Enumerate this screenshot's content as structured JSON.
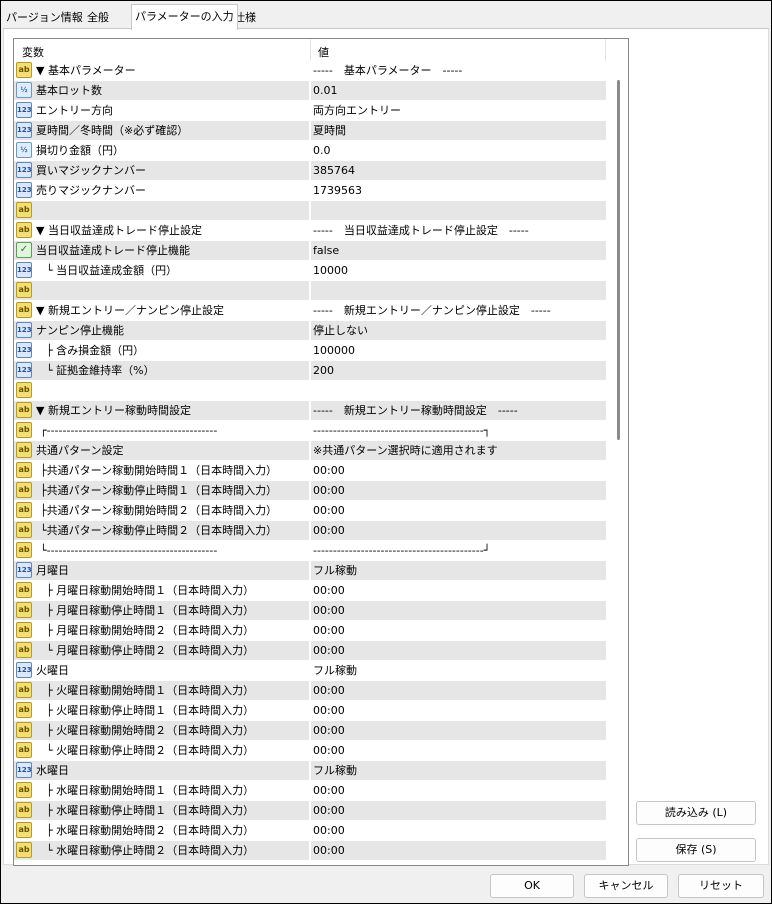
{
  "tabs": [
    "パージョン情報",
    "全般",
    "パラメーターの入力",
    "仕様"
  ],
  "grid": {
    "header_name": "変数",
    "header_value": "値",
    "rows": [
      {
        "icon": "ab",
        "name": "▼ 基本パラメーター",
        "value": "-----　基本パラメーター　-----"
      },
      {
        "icon": "frac",
        "name": "基本ロット数",
        "value": "0.01"
      },
      {
        "icon": "num",
        "name": "エントリー方向",
        "value": "両方向エントリー"
      },
      {
        "icon": "num",
        "name": "夏時間／冬時間（※必ず確認）",
        "value": "夏時間"
      },
      {
        "icon": "frac",
        "name": "損切り金額（円）",
        "value": "0.0"
      },
      {
        "icon": "num",
        "name": "買いマジックナンバー",
        "value": "385764"
      },
      {
        "icon": "num",
        "name": "売りマジックナンバー",
        "value": "1739563"
      },
      {
        "icon": "ab",
        "name": "",
        "value": ""
      },
      {
        "icon": "ab",
        "name": "▼ 当日収益達成トレード停止設定",
        "value": "-----　当日収益達成トレード停止設定　-----"
      },
      {
        "icon": "bool",
        "name": "当日収益達成トレード停止機能",
        "value": "false"
      },
      {
        "icon": "num",
        "indent": 2,
        "name": "└ 当日収益達成金額（円）",
        "value": "10000"
      },
      {
        "icon": "ab",
        "name": "",
        "value": ""
      },
      {
        "icon": "ab",
        "name": "▼ 新規エントリー／ナンピン停止設定",
        "value": "-----　新規エントリー／ナンピン停止設定　-----"
      },
      {
        "icon": "num",
        "name": "ナンピン停止機能",
        "value": "停止しない"
      },
      {
        "icon": "num",
        "indent": 2,
        "name": "├ 含み損金額（円）",
        "value": "100000"
      },
      {
        "icon": "num",
        "indent": 2,
        "name": "└ 証拠金維持率（%）",
        "value": "200"
      },
      {
        "icon": "ab",
        "name": "",
        "value": ""
      },
      {
        "icon": "ab",
        "name": "▼ 新規エントリー稼動時間設定",
        "value": "-----　新規エントリー稼動時間設定　-----"
      },
      {
        "icon": "ab",
        "indent": 1,
        "name": "┌-------------------------------------------",
        "value": "-------------------------------------------┐"
      },
      {
        "icon": "ab",
        "name": "共通パターン設定",
        "value": "※共通パターン選択時に適用されます"
      },
      {
        "icon": "ab",
        "indent": 1,
        "name": "├共通パターン稼動開始時間１（日本時間入力）",
        "value": "00:00"
      },
      {
        "icon": "ab",
        "indent": 1,
        "name": "├共通パターン稼動停止時間１（日本時間入力）",
        "value": "00:00"
      },
      {
        "icon": "ab",
        "indent": 1,
        "name": "├共通パターン稼動開始時間２（日本時間入力）",
        "value": "00:00"
      },
      {
        "icon": "ab",
        "indent": 1,
        "name": "└共通パターン稼動停止時間２（日本時間入力）",
        "value": "00:00"
      },
      {
        "icon": "ab",
        "indent": 1,
        "name": "└-------------------------------------------",
        "value": "-------------------------------------------┘"
      },
      {
        "icon": "num",
        "name": "月曜日",
        "value": "フル稼動"
      },
      {
        "icon": "ab",
        "indent": 2,
        "name": "├ 月曜日稼動開始時間１（日本時間入力）",
        "value": "00:00"
      },
      {
        "icon": "ab",
        "indent": 2,
        "name": "├ 月曜日稼動停止時間１（日本時間入力）",
        "value": "00:00"
      },
      {
        "icon": "ab",
        "indent": 2,
        "name": "├ 月曜日稼動開始時間２（日本時間入力）",
        "value": "00:00"
      },
      {
        "icon": "ab",
        "indent": 2,
        "name": "└ 月曜日稼動停止時間２（日本時間入力）",
        "value": "00:00"
      },
      {
        "icon": "num",
        "name": "火曜日",
        "value": "フル稼動"
      },
      {
        "icon": "ab",
        "indent": 2,
        "name": "├ 火曜日稼動開始時間１（日本時間入力）",
        "value": "00:00"
      },
      {
        "icon": "ab",
        "indent": 2,
        "name": "├ 火曜日稼動停止時間１（日本時間入力）",
        "value": "00:00"
      },
      {
        "icon": "ab",
        "indent": 2,
        "name": "├ 火曜日稼動開始時間２（日本時間入力）",
        "value": "00:00"
      },
      {
        "icon": "ab",
        "indent": 2,
        "name": "└ 火曜日稼動停止時間２（日本時間入力）",
        "value": "00:00"
      },
      {
        "icon": "num",
        "name": "水曜日",
        "value": "フル稼動"
      },
      {
        "icon": "ab",
        "indent": 2,
        "name": "├ 水曜日稼動開始時間１（日本時間入力）",
        "value": "00:00"
      },
      {
        "icon": "ab",
        "indent": 2,
        "name": "├ 水曜日稼動停止時間１（日本時間入力）",
        "value": "00:00"
      },
      {
        "icon": "ab",
        "indent": 2,
        "name": "├ 水曜日稼動開始時間２（日本時間入力）",
        "value": "00:00"
      },
      {
        "icon": "ab",
        "indent": 2,
        "name": "└ 水曜日稼動停止時間２（日本時間入力）",
        "value": "00:00"
      }
    ]
  },
  "buttons": {
    "load": "読み込み (L)",
    "save": "保存 (S)",
    "ok": "OK",
    "cancel": "キャンセル",
    "reset": "リセット"
  },
  "icon_glyphs": {
    "ab": "ab",
    "num": "123",
    "frac": "½",
    "bool": "✓"
  }
}
